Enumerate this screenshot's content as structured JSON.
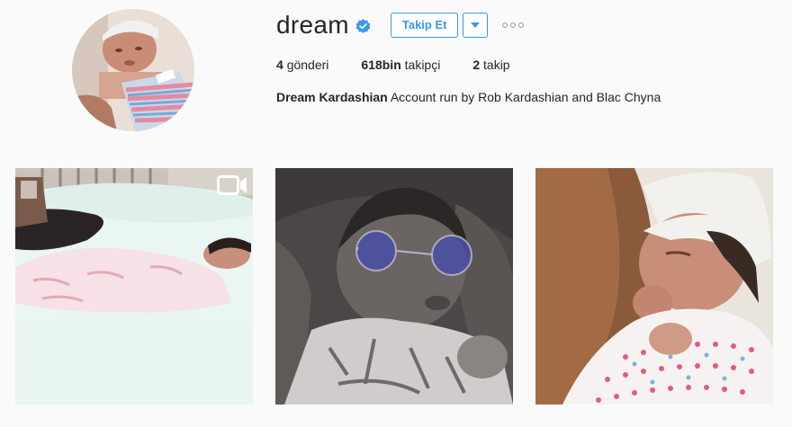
{
  "profile": {
    "username": "dream",
    "verified": true,
    "follow_label": "Takip Et",
    "stats": [
      {
        "count": "4",
        "label": "gönderi"
      },
      {
        "count": "618bin",
        "label": "takipçi"
      },
      {
        "count": "2",
        "label": "takip"
      }
    ],
    "full_name": "Dream Kardashian",
    "bio": "Account run by Rob Kardashian and Blac Chyna"
  },
  "icons": {
    "verified": "verified-badge-icon",
    "dropdown": "chevron-down-icon",
    "more": "more-options-icon",
    "video": "video-camera-icon"
  },
  "colors": {
    "accent": "#3897f0",
    "text": "#262626",
    "background": "#fafafa"
  }
}
